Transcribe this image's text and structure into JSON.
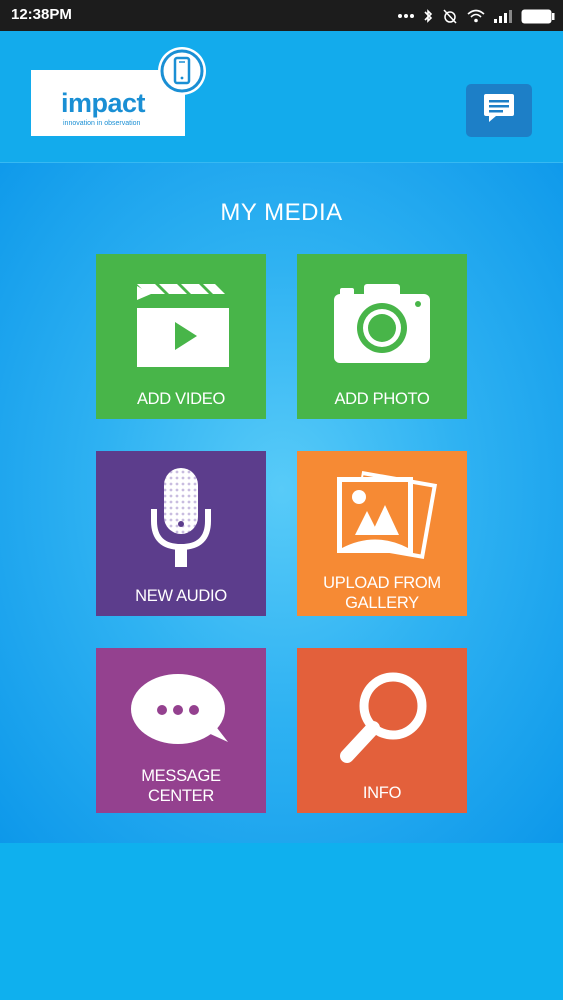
{
  "status_bar": {
    "time": "12:38PM",
    "icons": [
      "more-dots-icon",
      "bluetooth-icon",
      "alarm-off-icon",
      "wifi-icon",
      "signal-icon",
      "battery-icon"
    ]
  },
  "header": {
    "logo": {
      "word": "impact",
      "tagline": "innovation in observation"
    },
    "chat_button_icon": "chat-bubble-icon"
  },
  "main": {
    "title": "MY MEDIA",
    "tiles": [
      {
        "id": "add-video",
        "label": "ADD VIDEO",
        "icon": "clapperboard-icon",
        "color": "#48b549"
      },
      {
        "id": "add-photo",
        "label": "ADD PHOTO",
        "icon": "camera-icon",
        "color": "#48b549"
      },
      {
        "id": "new-audio",
        "label": "NEW AUDIO",
        "icon": "microphone-icon",
        "color": "#5c3d8c"
      },
      {
        "id": "upload-gallery",
        "label_line1": "UPLOAD FROM",
        "label_line2": "GALLERY",
        "icon": "gallery-icon",
        "color": "#f68a34"
      },
      {
        "id": "message-center",
        "label_line1": "MESSAGE",
        "label_line2": "CENTER",
        "icon": "speech-bubble-icon",
        "color": "#94418f"
      },
      {
        "id": "info",
        "label": "INFO",
        "icon": "magnifier-icon",
        "color": "#e3603b"
      }
    ]
  },
  "colors": {
    "status_bar": "#1c1c1c",
    "header": "#13abec",
    "chat_button": "#1d7fc7",
    "footer": "#0fb0ee"
  }
}
